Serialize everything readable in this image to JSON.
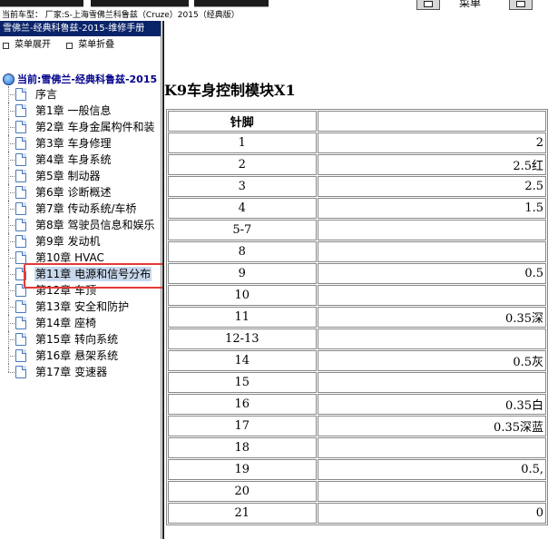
{
  "toolbar": {
    "menu_label": "菜单"
  },
  "vehicle_line": "当前车型：  厂家:S-上海雪佛兰科鲁兹（Cruze）2015（经典版）",
  "left_pane": {
    "header": "雪佛兰-经典科鲁兹-2015-维修手册",
    "expand_label": "菜单展开",
    "collapse_label": "菜单折叠",
    "root_label": "当前:雪佛兰-经典科鲁兹-2015",
    "items": [
      {
        "label": "序言"
      },
      {
        "label": "第1章 一般信息"
      },
      {
        "label": "第2章 车身金属构件和装"
      },
      {
        "label": "第3章 车身修理"
      },
      {
        "label": "第4章 车身系统"
      },
      {
        "label": "第5章 制动器"
      },
      {
        "label": "第6章 诊断概述"
      },
      {
        "label": "第7章 传动系统/车桥"
      },
      {
        "label": "第8章 驾驶员信息和娱乐"
      },
      {
        "label": "第9章 发动机"
      },
      {
        "label": "第10章 HVAC"
      },
      {
        "label": "第11章 电源和信号分布"
      },
      {
        "label": "第12章 车顶"
      },
      {
        "label": "第13章 安全和防护"
      },
      {
        "label": "第14章 座椅"
      },
      {
        "label": "第15章 转向系统"
      },
      {
        "label": "第16章 悬架系统"
      },
      {
        "label": "第17章 变速器"
      }
    ],
    "selected_index": 11,
    "highlight_color": "#e53935"
  },
  "content": {
    "title": "K9车身控制模块X1",
    "table": {
      "header": [
        "针脚",
        ""
      ],
      "rows": [
        [
          "1",
          "2"
        ],
        [
          "2",
          "2.5红"
        ],
        [
          "3",
          "2.5"
        ],
        [
          "4",
          "1.5"
        ],
        [
          "5-7",
          ""
        ],
        [
          "8",
          ""
        ],
        [
          "9",
          "0.5"
        ],
        [
          "10",
          ""
        ],
        [
          "11",
          "0.35深"
        ],
        [
          "12-13",
          ""
        ],
        [
          "14",
          "0.5灰"
        ],
        [
          "15",
          ""
        ],
        [
          "16",
          "0.35白"
        ],
        [
          "17",
          "0.35深蓝"
        ],
        [
          "18",
          ""
        ],
        [
          "19",
          "0.5,"
        ],
        [
          "20",
          ""
        ],
        [
          "21",
          "0"
        ]
      ]
    }
  }
}
